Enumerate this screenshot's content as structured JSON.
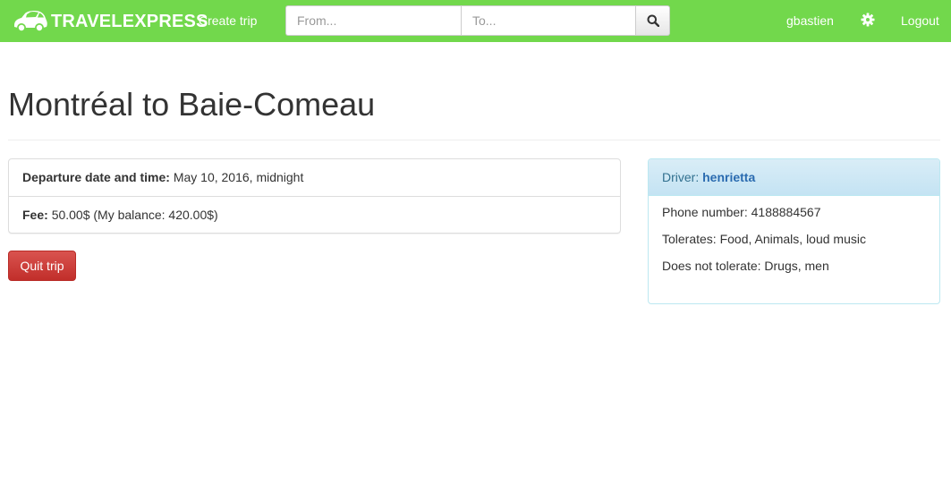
{
  "navbar": {
    "brand": "TRAVELEXPRESS",
    "create_trip": "Create trip",
    "search": {
      "from_placeholder": "From...",
      "to_placeholder": "To..."
    },
    "username": "gbastien",
    "logout": "Logout"
  },
  "page": {
    "title": "Montréal to Baie-Comeau"
  },
  "trip": {
    "departure_label": "Departure date and time:",
    "departure_value": "May 10, 2016, midnight",
    "fee_label": "Fee:",
    "fee_value": "50.00$ (My balance: 420.00$)"
  },
  "actions": {
    "quit_trip": "Quit trip"
  },
  "driver": {
    "label": "Driver:",
    "name": "henrietta",
    "phone": "Phone number: 4188884567",
    "tolerates": "Tolerates: Food, Animals, loud music",
    "not_tolerates": "Does not tolerate: Drugs, men"
  },
  "colors": {
    "navbar_bg": "#72d84c",
    "danger": "#d9534f",
    "info_panel_border": "#bce8f1",
    "info_heading_bg": "#d9edf7",
    "link": "#2a6bb0"
  }
}
